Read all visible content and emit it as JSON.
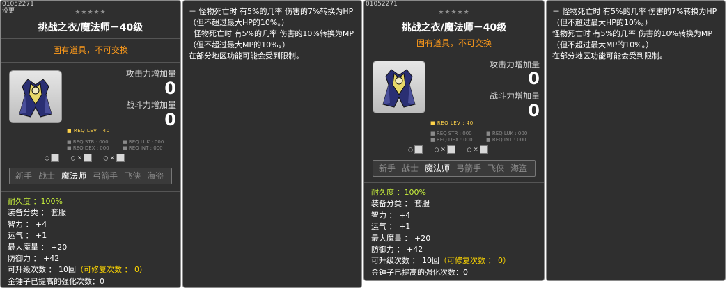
{
  "left": {
    "item_id": "01052271",
    "item_id_sub": "没更",
    "stars": "★★★★★",
    "title": "挑战之衣/魔法师－40级",
    "untradable": "固有道具，不可交换",
    "attack_label": "攻击力增加量",
    "attack_value": "0",
    "battle_label": "战斗力增加量",
    "battle_value": "0",
    "req_lev": "■ REQ LEV :   40",
    "req_str": "■ REQ STR : 000",
    "req_luk": "■ REQ LUK : 000",
    "req_dex": "■ REQ DEX : 000",
    "req_int": "■ REQ INT : 000",
    "mini1": "○",
    "mini2": "○ ✕",
    "mini3": "○ ✕",
    "jobs": [
      "新手",
      "战士",
      "魔法师",
      "弓箭手",
      "飞侠",
      "海盗"
    ],
    "stat_lines": {
      "durability": "耐久度 ：100%",
      "category": "装备分类 ：  套服",
      "int": "智力 ：  +4",
      "luk": "运气 ：  +1",
      "mp": "最大魔量 ：  +20",
      "def": "防御力 ：  +42",
      "upgrades_a": "可升级次数 ： 10回",
      "upgrades_b": "（可修复次数 ： 0）",
      "hammer": "金锤子已提高的强化次数：0"
    }
  },
  "left_desc": "－ 怪物死亡时 有5%的几率 伤害的7%转换为HP\n（但不超过最大HP的10%。）\n  怪物死亡时 有5%的几率 伤害的10%转换为MP\n（但不超过最大MP的10%。）\n在部分地区功能可能会受到限制。",
  "right": {
    "item_id": "01052271",
    "stars": "★★★★★",
    "title": "挑战之衣/魔法师－40级",
    "untradable": "固有道具，不可交换",
    "attack_label": "攻击力增加量",
    "attack_value": "0",
    "battle_label": "战斗力增加量",
    "battle_value": "0",
    "req_lev": "■ REQ LEV :   40",
    "req_str": "■ REQ STR : 000",
    "req_luk": "■ REQ LUK : 000",
    "req_dex": "■ REQ DEX : 000",
    "req_int": "■ REQ INT : 000",
    "mini1": "○",
    "mini2": "○ ✕",
    "mini3": "○ ✕",
    "jobs": [
      "新手",
      "战士",
      "魔法师",
      "弓箭手",
      "飞侠",
      "海盗"
    ],
    "stat_lines": {
      "durability": "耐久度 ：100%",
      "category": "装备分类 ：  套服",
      "int": "智力 ：  +4",
      "luk": "运气 ：  +1",
      "mp": "最大魔量 ：  +20",
      "def": "防御力 ：  +42",
      "upgrades_a": "可升级次数 ： 10回",
      "upgrades_b": "（可修复次数 ： 0）",
      "hammer": "金锤子已提高的强化次数：0"
    }
  },
  "right_desc": "－ 怪物死亡时 有5%的几率 伤害的7%转换为HP\n（但不超过最大HP的10%。）\n怪物死亡时 有5%的几率 伤害的10%转换为MP\n（但不超过最大MP的10%。）\n在部分地区功能可能会受到限制。",
  "colors": {
    "panel_bg": "#2f2f2f",
    "untradable": "#ff9b1a",
    "durability": "#c7ef3c",
    "gold_text": "#ffd700",
    "req_lev": "#ffd34a"
  }
}
